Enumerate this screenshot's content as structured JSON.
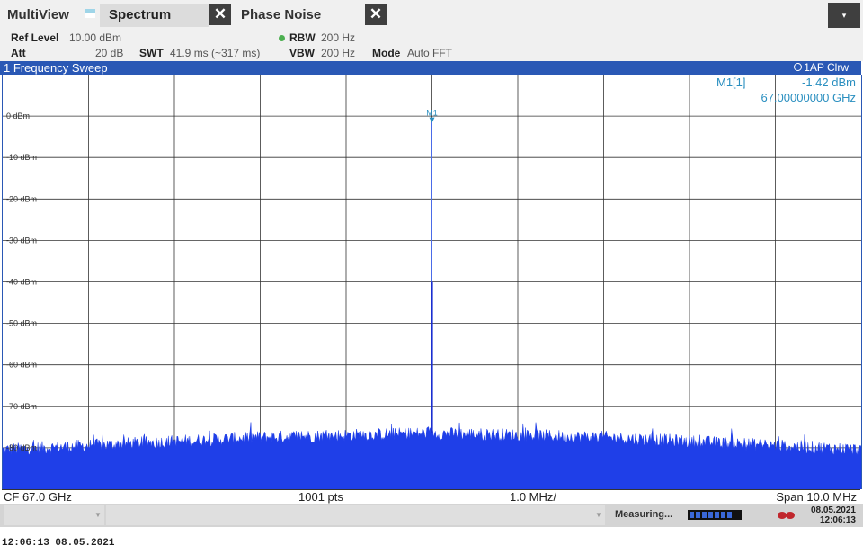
{
  "tabs": {
    "multiview_label": "MultiView",
    "spectrum_label": "Spectrum",
    "phase_noise_label": "Phase Noise",
    "close_glyph": "✕",
    "menu_glyph": "▾"
  },
  "params": {
    "ref_level_label": "Ref Level",
    "ref_level_value": "10.00 dBm",
    "att_label": "Att",
    "att_value": "20 dB",
    "swt_label": "SWT",
    "swt_value": "41.9 ms (~317 ms)",
    "rbw_label": "RBW",
    "rbw_value": "200 Hz",
    "vbw_label": "VBW",
    "vbw_value": "200 Hz",
    "mode_label": "Mode",
    "mode_value": "Auto FFT"
  },
  "window": {
    "title": "1 Frequency Sweep",
    "trace_info": "1AP Clrw"
  },
  "marker": {
    "label": "M1",
    "table_label": "M1[1]",
    "level": "-1.42 dBm",
    "frequency": "67.00000000 GHz"
  },
  "footer": {
    "center_freq": "CF 67.0 GHz",
    "points": "1001 pts",
    "per_div": "1.0 MHz/",
    "span": "Span 10.0 MHz"
  },
  "status": {
    "measuring": "Measuring...",
    "progress_fraction": 0.88,
    "date": "08.05.2021",
    "time": "12:06:13"
  },
  "stamp": "12:06:13  08.05.2021",
  "colors": {
    "accent": "#2a58b5",
    "trace": "#1f3fe8",
    "marker": "#2a8fc0",
    "grid": "#333333"
  },
  "chart_data": {
    "type": "line",
    "title": "1 Frequency Sweep",
    "xlabel": "",
    "ylabel": "",
    "ylim": [
      -90,
      10
    ],
    "xlim_ghz": [
      66.995,
      67.005
    ],
    "y_ticks": [
      "0 dBm",
      "-10 dBm",
      "-20 dBm",
      "-30 dBm",
      "-40 dBm",
      "-50 dBm",
      "-60 dBm",
      "-70 dBm",
      "-80 dBm"
    ],
    "y_tick_values": [
      0,
      -10,
      -20,
      -30,
      -40,
      -50,
      -60,
      -70,
      -80
    ],
    "grid": true,
    "noise_floor_dbm": {
      "x_offset_mhz": [
        -5,
        -4,
        -3,
        -2,
        -1,
        0,
        1,
        2,
        3,
        4,
        5
      ],
      "values": [
        -80.5,
        -79.5,
        -78.5,
        -77.5,
        -77,
        -76.5,
        -77,
        -77.5,
        -78.5,
        -79.5,
        -80.5
      ]
    },
    "peak": {
      "x_ghz": 67.0,
      "y_dbm": -1.42
    }
  }
}
